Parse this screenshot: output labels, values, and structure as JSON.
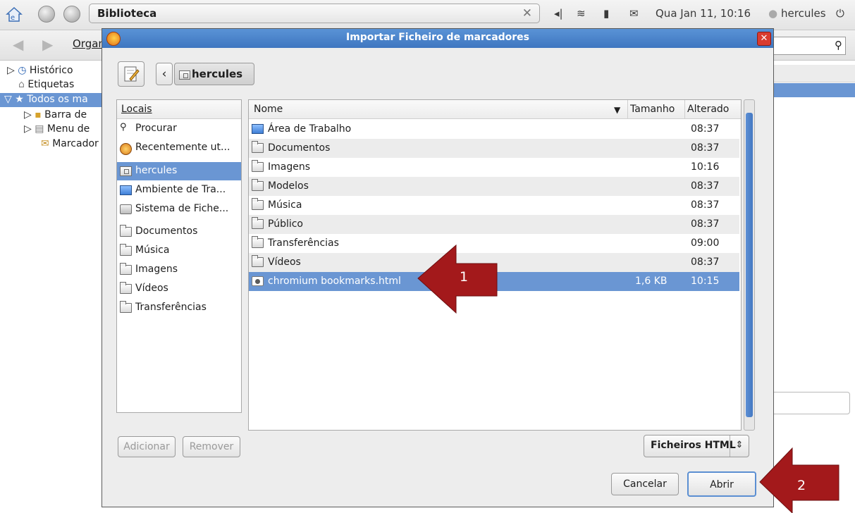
{
  "panel": {
    "window_title": "Biblioteca",
    "clock": "Qua Jan 11, 10:16",
    "user": "hercules"
  },
  "library": {
    "organize_label": "Organ",
    "tree": [
      {
        "label": "Histórico"
      },
      {
        "label": "Etiquetas"
      },
      {
        "label": "Todos os ma"
      },
      {
        "label": "Barra de"
      },
      {
        "label": "Menu de"
      },
      {
        "label": "Marcador"
      }
    ]
  },
  "dialog": {
    "title": "Importar Ficheiro de marcadores",
    "breadcrumb": "hercules",
    "places_header": "Locais",
    "places": [
      {
        "label": "Procurar",
        "icon": "binoculars-icon"
      },
      {
        "label": "Recentemente ut...",
        "icon": "recent-icon"
      },
      {
        "label": "hercules",
        "icon": "home-folder-icon",
        "selected": true
      },
      {
        "label": "Ambiente de Tra...",
        "icon": "desktop-icon"
      },
      {
        "label": "Sistema de Fiche...",
        "icon": "drive-icon"
      },
      {
        "label": "Documentos",
        "icon": "folder-icon"
      },
      {
        "label": "Música",
        "icon": "folder-icon"
      },
      {
        "label": "Imagens",
        "icon": "folder-icon"
      },
      {
        "label": "Vídeos",
        "icon": "folder-icon"
      },
      {
        "label": "Transferências",
        "icon": "folder-icon"
      }
    ],
    "columns": {
      "name": "Nome",
      "size": "Tamanho",
      "modified": "Alterado"
    },
    "files": [
      {
        "name": "Área de Trabalho",
        "size": "",
        "modified": "08:37",
        "icon": "desktop-icon"
      },
      {
        "name": "Documentos",
        "size": "",
        "modified": "08:37",
        "icon": "folder-icon"
      },
      {
        "name": "Imagens",
        "size": "",
        "modified": "10:16",
        "icon": "folder-icon"
      },
      {
        "name": "Modelos",
        "size": "",
        "modified": "08:37",
        "icon": "folder-icon"
      },
      {
        "name": "Música",
        "size": "",
        "modified": "08:37",
        "icon": "folder-icon"
      },
      {
        "name": "Público",
        "size": "",
        "modified": "08:37",
        "icon": "folder-icon"
      },
      {
        "name": "Transferências",
        "size": "",
        "modified": "09:00",
        "icon": "folder-icon"
      },
      {
        "name": "Vídeos",
        "size": "",
        "modified": "08:37",
        "icon": "folder-icon"
      },
      {
        "name": "chromium bookmarks.html",
        "size": "1,6 KB",
        "modified": "10:15",
        "icon": "html-file-icon",
        "selected": true
      }
    ],
    "add_label": "Adicionar",
    "remove_label": "Remover",
    "filter_label": "Ficheiros HTML",
    "cancel_label": "Cancelar",
    "open_label": "Abrir"
  },
  "annotations": [
    {
      "label": "1"
    },
    {
      "label": "2"
    }
  ],
  "colors": {
    "selection": "#6a96d3",
    "titlebar": "#4a83cb",
    "annotation_arrow": "#b21f1f"
  }
}
